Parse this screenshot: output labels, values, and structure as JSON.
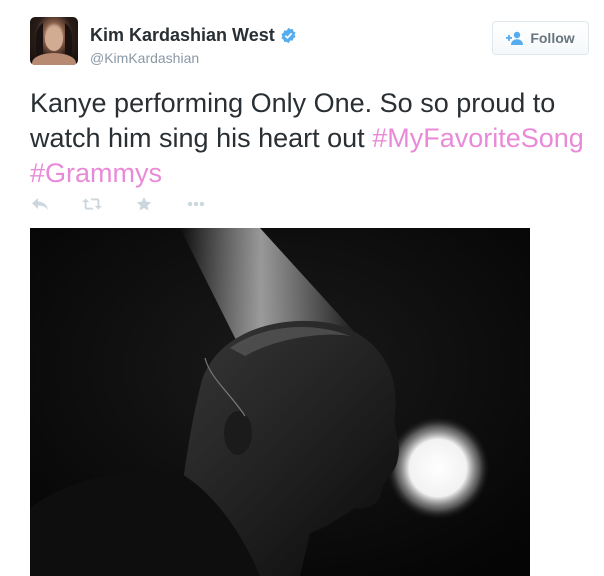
{
  "user": {
    "display_name": "Kim Kardashian West",
    "handle": "@KimKardashian",
    "verified": true,
    "avatar_icon": "avatar-photo"
  },
  "follow_button": {
    "label": "Follow",
    "icon": "add-user-icon"
  },
  "tweet": {
    "text": "Kanye performing Only One. So so proud to watch him sing his heart out",
    "hashtags": [
      "#MyFavoriteSong",
      "#Grammys"
    ]
  },
  "actions": [
    {
      "name": "reply",
      "icon": "reply-icon"
    },
    {
      "name": "retweet",
      "icon": "retweet-icon"
    },
    {
      "name": "favorite",
      "icon": "star-icon"
    },
    {
      "name": "more",
      "icon": "more-icon"
    }
  ],
  "colors": {
    "hashtag": "#e98ad8",
    "verified": "#55acee",
    "handle": "#8899a6",
    "text": "#292f33"
  }
}
